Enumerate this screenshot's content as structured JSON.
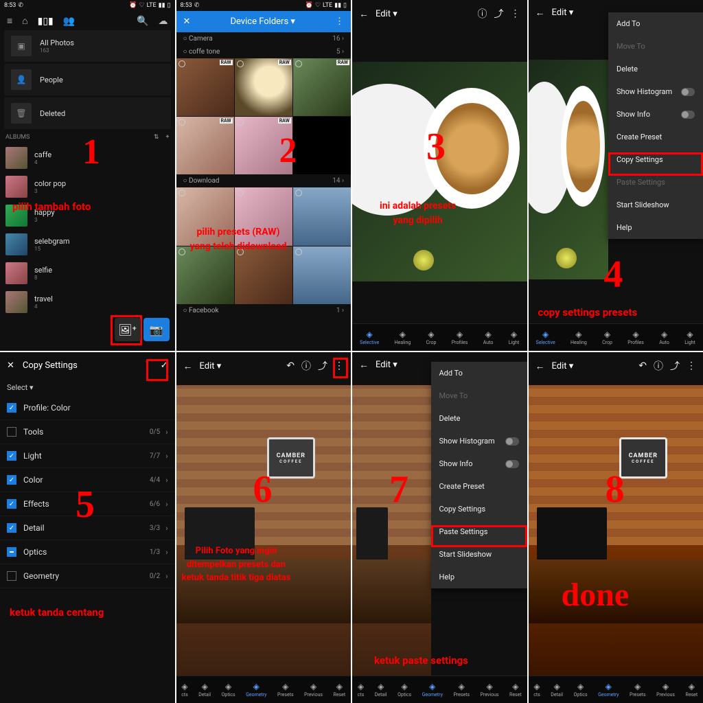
{
  "status": {
    "time": "8:53",
    "net": "LTE"
  },
  "p1": {
    "all": "All Photos",
    "allct": "163",
    "people": "People",
    "deleted": "Deleted",
    "albums": "ALBUMS",
    "items": [
      {
        "name": "caffe",
        "ct": "4"
      },
      {
        "name": "color pop",
        "ct": "3"
      },
      {
        "name": "happy",
        "ct": "3"
      },
      {
        "name": "selebgram",
        "ct": "15"
      },
      {
        "name": "selfie",
        "ct": "8"
      },
      {
        "name": "travel",
        "ct": "4"
      }
    ],
    "num": "1",
    "note": "pilih tambah foto"
  },
  "p2": {
    "title": "Device Folders",
    "rows": [
      {
        "name": "Camera",
        "ct": "16"
      },
      {
        "name": "coffe tone",
        "ct": "5"
      },
      {
        "name": "Download",
        "ct": "14"
      },
      {
        "name": "Facebook",
        "ct": "1"
      }
    ],
    "raw": "RAW",
    "num": "2",
    "note": "pilih presets (RAW)\nyang telah didownload"
  },
  "edit": "Edit",
  "tools": [
    "Selective",
    "Healing",
    "Crop",
    "Profiles",
    "Auto",
    "Light"
  ],
  "tools2": [
    "cts",
    "Detail",
    "Optics",
    "Geometry",
    "Presets",
    "Previous",
    "Reset"
  ],
  "p3": {
    "num": "3",
    "note": "ini adalah presets\nyang dipilih"
  },
  "menu": {
    "add": "Add To",
    "move": "Move To",
    "del": "Delete",
    "hist": "Show Histogram",
    "info": "Show Info",
    "create": "Create Preset",
    "copy": "Copy Settings",
    "paste": "Paste Settings",
    "slide": "Start Slideshow",
    "help": "Help"
  },
  "p4": {
    "num": "4",
    "note": "copy settings presets"
  },
  "p5": {
    "title": "Copy Settings",
    "select": "Select",
    "items": [
      {
        "name": "Profile: Color",
        "on": true,
        "ct": ""
      },
      {
        "name": "Tools",
        "on": false,
        "ct": "0/5"
      },
      {
        "name": "Light",
        "on": true,
        "ct": "7/7"
      },
      {
        "name": "Color",
        "on": true,
        "ct": "4/4"
      },
      {
        "name": "Effects",
        "on": true,
        "ct": "6/6"
      },
      {
        "name": "Detail",
        "on": true,
        "ct": "3/3"
      },
      {
        "name": "Optics",
        "on": "half",
        "ct": "1/3"
      },
      {
        "name": "Geometry",
        "on": false,
        "ct": "0/2"
      }
    ],
    "num": "5",
    "note": "ketuk tanda centang"
  },
  "sign": {
    "l1": "CAMBER",
    "l2": "COFFEE"
  },
  "p6": {
    "num": "6",
    "note": "Pilih Foto yang ingin\nditempelkan presets dan\nketuk tanda titik tiga diatas"
  },
  "p7": {
    "num": "7",
    "note": "ketuk paste settings"
  },
  "p8": {
    "num": "8",
    "note": "done"
  }
}
